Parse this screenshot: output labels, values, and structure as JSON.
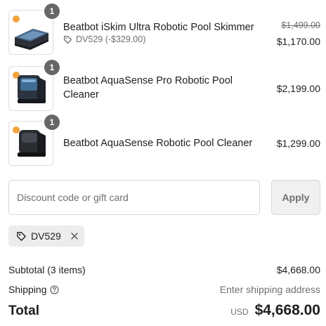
{
  "items": [
    {
      "name": "Beatbot iSkim Ultra Robotic Pool Skimmer",
      "quantity": "1",
      "discount_code": "DV529 (-$329.00)",
      "original_price": "$1,499.00",
      "price": "$1,170.00"
    },
    {
      "name": "Beatbot AquaSense Pro Robotic Pool Cleaner",
      "quantity": "1",
      "price": "$2,199.00"
    },
    {
      "name": "Beatbot AquaSense Robotic Pool Cleaner",
      "quantity": "1",
      "price": "$1,299.00"
    }
  ],
  "discount": {
    "placeholder": "Discount code or gift card",
    "apply_label": "Apply",
    "applied_code": "DV529"
  },
  "summary": {
    "subtotal_label": "Subtotal (3 items)",
    "subtotal_value": "$4,668.00",
    "shipping_label": "Shipping",
    "shipping_value": "Enter shipping address",
    "total_label": "Total",
    "currency": "USD",
    "total_value": "$4,668.00"
  },
  "icons": {
    "tag": "tag-icon",
    "remove": "close-icon",
    "help": "question-circle-icon"
  },
  "colors": {
    "text": "#1f1f1f",
    "muted": "#707070",
    "badge": "#666666",
    "chip_bg": "#ececec"
  }
}
